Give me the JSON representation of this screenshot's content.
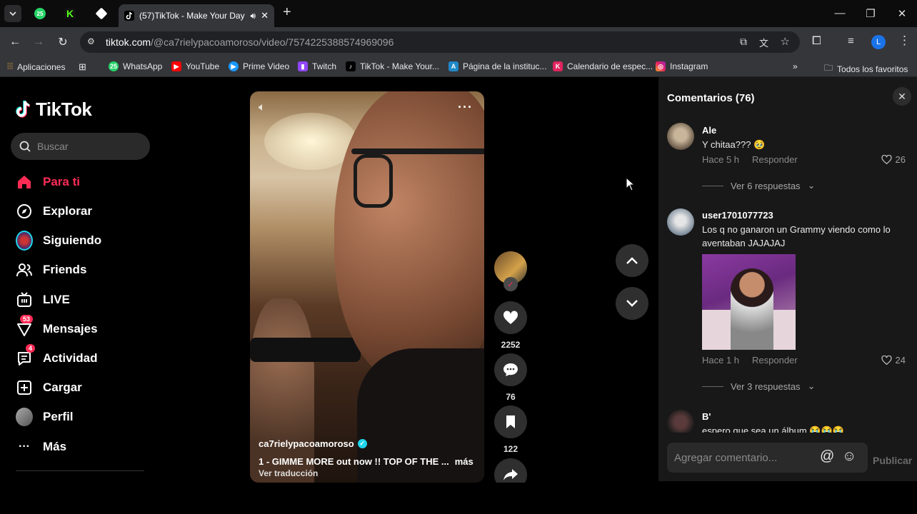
{
  "browser": {
    "tabs": [
      {
        "label": "25",
        "color": "#25d366"
      },
      {
        "label": "K",
        "color": "#53fc18"
      },
      {
        "label": "",
        "color": "#ffffff"
      }
    ],
    "active_tab": {
      "title": "(57)TikTok - Make Your Day"
    },
    "url": {
      "host": "tiktok.com",
      "path": "/@ca7rielypacoamoroso/video/7574225388574969096"
    },
    "profile_initial": "L",
    "bookmarks": [
      {
        "label": "Aplicaciones",
        "icon": "apps-icon"
      },
      {
        "label": "WhatsApp",
        "icon": "whatsapp-icon"
      },
      {
        "label": "YouTube",
        "icon": "youtube-icon"
      },
      {
        "label": "Prime Video",
        "icon": "prime-video-icon"
      },
      {
        "label": "Twitch",
        "icon": "twitch-icon"
      },
      {
        "label": "TikTok - Make Your...",
        "icon": "tiktok-icon"
      },
      {
        "label": "Página de la instituc...",
        "icon": "institution-icon"
      },
      {
        "label": "Calendario de espec...",
        "icon": "calendar-icon"
      },
      {
        "label": "Instagram",
        "icon": "instagram-icon"
      }
    ],
    "all_bookmarks": "Todos los favoritos"
  },
  "sidebar": {
    "logo": "TikTok",
    "search_placeholder": "Buscar",
    "items": [
      {
        "label": "Para ti",
        "active": true
      },
      {
        "label": "Explorar"
      },
      {
        "label": "Siguiendo"
      },
      {
        "label": "Friends"
      },
      {
        "label": "LIVE"
      },
      {
        "label": "Mensajes",
        "badge": "53"
      },
      {
        "label": "Actividad",
        "badge": "4"
      },
      {
        "label": "Cargar"
      },
      {
        "label": "Perfil"
      },
      {
        "label": "Más"
      }
    ]
  },
  "video": {
    "username": "ca7rielypacoamoroso",
    "description": "1 - GIMME MORE  out now !!  TOP OF THE ...",
    "more": "más",
    "translate": "Ver traducción",
    "likes": "2252",
    "comments": "76",
    "saves": "122"
  },
  "comments_panel": {
    "title": "Comentarios (76)",
    "comments": [
      {
        "user": "Ale",
        "text": "Y chitaa???",
        "emoji": "🥹",
        "time": "Hace 5 h",
        "reply": "Responder",
        "likes": "26",
        "replies": "Ver 6 respuestas"
      },
      {
        "user": "user1701077723",
        "text": "Los q no ganaron un Grammy viendo como lo aventaban JAJAJAJ",
        "time": "Hace 1 h",
        "reply": "Responder",
        "likes": "24",
        "replies": "Ver 3 respuestas"
      },
      {
        "user": "B'",
        "text": "espero que sea un álbum",
        "emoji": "😭😭😭"
      }
    ],
    "composer_placeholder": "Agregar comentario...",
    "publish": "Publicar"
  },
  "colors": {
    "accent": "#fe2c55",
    "verified": "#20d5ec",
    "panel": "#181818"
  }
}
